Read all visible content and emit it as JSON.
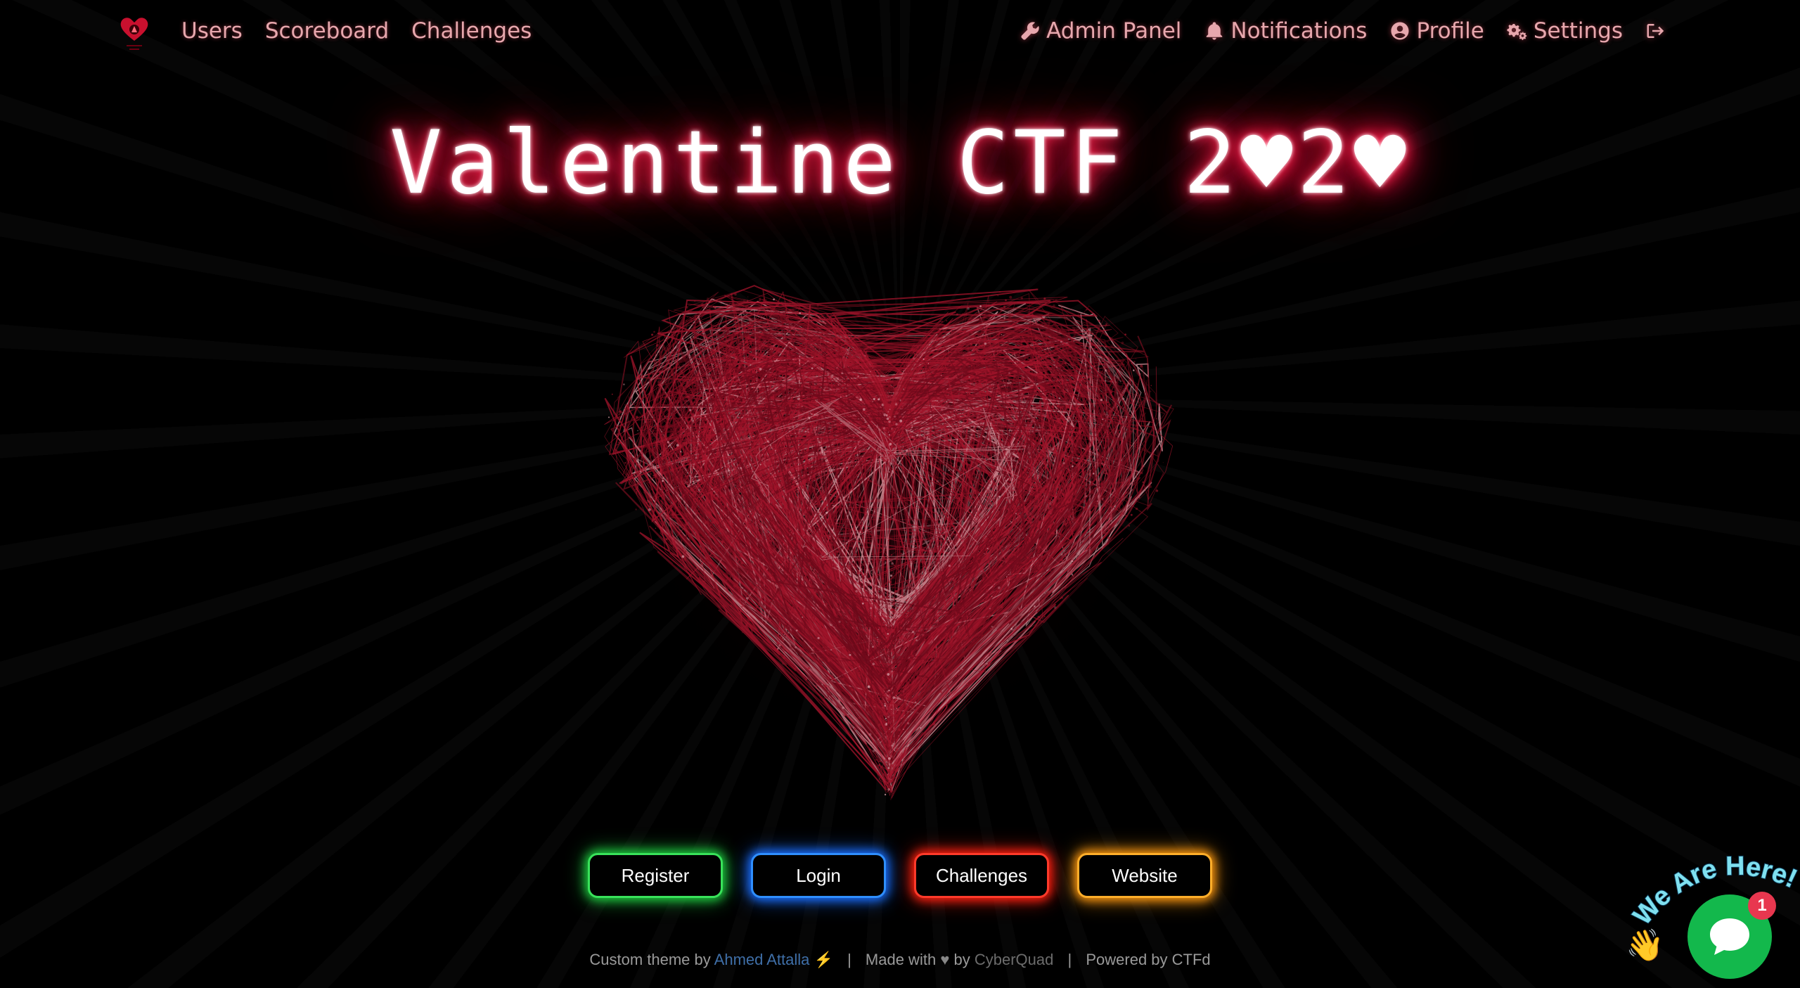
{
  "nav": {
    "left": [
      {
        "label": "Users"
      },
      {
        "label": "Scoreboard"
      },
      {
        "label": "Challenges"
      }
    ],
    "right": [
      {
        "label": "Admin Panel",
        "icon": "wrench-icon"
      },
      {
        "label": "Notifications",
        "icon": "bell-icon"
      },
      {
        "label": "Profile",
        "icon": "user-circle-icon"
      },
      {
        "label": "Settings",
        "icon": "gears-icon"
      },
      {
        "label": "",
        "icon": "logout-icon"
      }
    ]
  },
  "hero": {
    "title": "Valentine CTF 2♥2♥"
  },
  "buttons": {
    "register": "Register",
    "login": "Login",
    "challenges": "Challenges",
    "website": "Website"
  },
  "footer": {
    "custom_theme_by": "Custom theme by",
    "author": "Ahmed Attalla",
    "bolt": "⚡",
    "sep1": "|",
    "made_with": "Made with",
    "heart": "♥",
    "by": "by",
    "org": "CyberQuad",
    "sep2": "|",
    "powered_by": "Powered by CTFd"
  },
  "chat": {
    "banner": "We Are Here!",
    "badge_count": "1",
    "wave": "👋"
  },
  "colors": {
    "nav_text": "#e7a7ad",
    "title_glow": "#ff1744",
    "register_glow": "#39e25a",
    "login_glow": "#2f8fff",
    "challenges_glow": "#ff3a2a",
    "website_glow": "#ffae2a",
    "chat_green": "#13b84c",
    "badge_red": "#e8374f"
  }
}
